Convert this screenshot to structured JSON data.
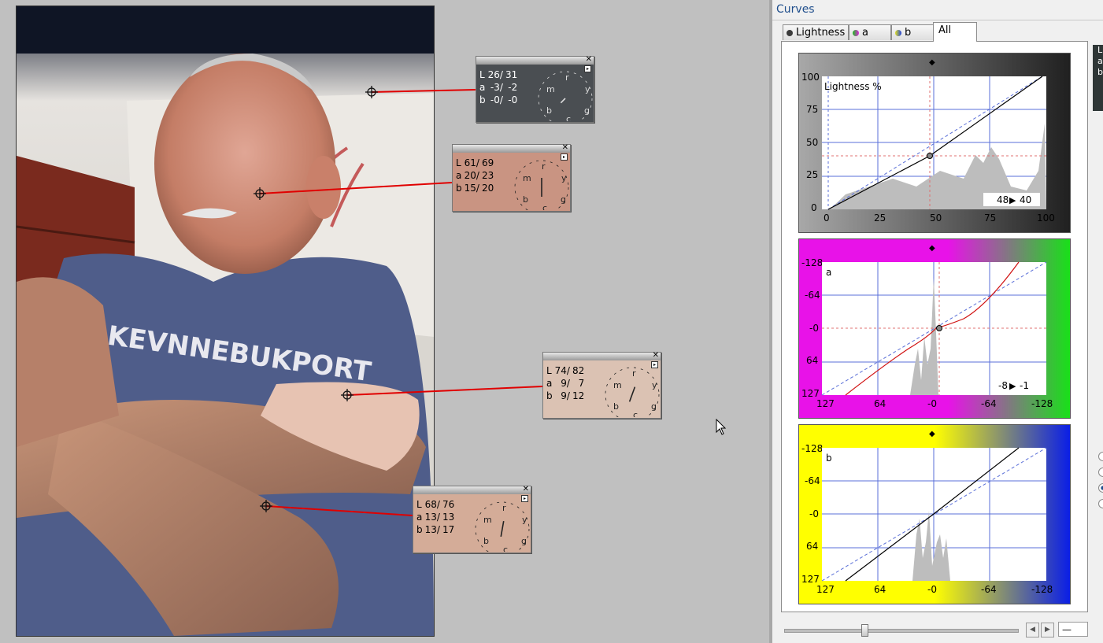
{
  "panel": {
    "title": "Curves",
    "tabs": [
      {
        "label": "Lightness",
        "active": false,
        "dot": "#3a3a3a"
      },
      {
        "label": "a",
        "active": false,
        "dot": "#d040d0"
      },
      {
        "label": "b",
        "active": false,
        "dot": "#4060e0"
      },
      {
        "label": "All",
        "active": true,
        "dot": ""
      }
    ],
    "side_letters": [
      "L",
      "a",
      "b"
    ],
    "zoom_value": "—"
  },
  "probes": [
    {
      "L": [
        "26/",
        "31"
      ],
      "a": [
        "-3/",
        "-2"
      ],
      "b": [
        "-0/",
        "-0"
      ]
    },
    {
      "L": [
        "61/",
        "69"
      ],
      "a": [
        "20/",
        "23"
      ],
      "b": [
        "15/",
        "20"
      ]
    },
    {
      "L": [
        "74/",
        "82"
      ],
      "a": [
        "9/",
        "7"
      ],
      "b": [
        "9/",
        "12"
      ]
    },
    {
      "L": [
        "68/",
        "76"
      ],
      "a": [
        "13/",
        "13"
      ],
      "b": [
        "13/",
        "17"
      ]
    }
  ],
  "wheel_letters": {
    "r": "r",
    "y": "y",
    "g": "g",
    "c": "c",
    "b": "b",
    "m": "m"
  },
  "graphs": {
    "lightness": {
      "title": "Lightness %",
      "x_ticks": [
        "0",
        "25",
        "50",
        "75",
        "100"
      ],
      "y_ticks": [
        "100",
        "75",
        "50",
        "25",
        "0"
      ],
      "readout_in": "48",
      "readout_out": "40",
      "gradient": [
        "#9a9a9a",
        "#000000"
      ]
    },
    "a": {
      "title": "a",
      "x_ticks": [
        "127",
        "64",
        "-0",
        "-64",
        "-128"
      ],
      "y_ticks": [
        "-128",
        "-64",
        "-0",
        "64",
        "127"
      ],
      "readout_in": "-8",
      "readout_out": "-1",
      "gradient": [
        "#e812e8",
        "#19e019"
      ]
    },
    "b": {
      "title": "b",
      "x_ticks": [
        "127",
        "64",
        "-0",
        "-64",
        "-128"
      ],
      "y_ticks": [
        "-128",
        "-64",
        "-0",
        "64",
        "127"
      ],
      "gradient": [
        "#ffff00",
        "#0a1ee6"
      ]
    }
  },
  "colors": {
    "leader_line": "#e00000",
    "accent": "#1f4e8c"
  }
}
